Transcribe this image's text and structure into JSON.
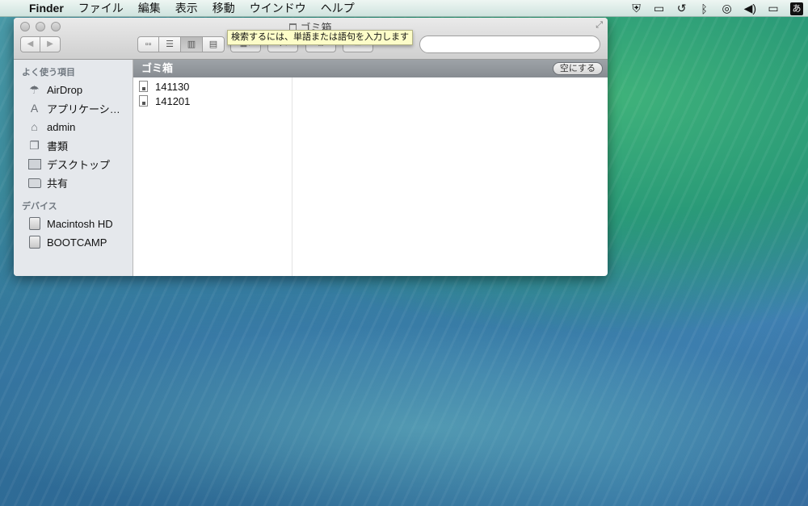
{
  "menubar": {
    "apple": "",
    "app": "Finder",
    "items": [
      "ファイル",
      "編集",
      "表示",
      "移動",
      "ウインドウ",
      "ヘルプ"
    ],
    "ime": "あ"
  },
  "window": {
    "title": "ゴミ箱",
    "tooltip": "検索するには、単語または語句を入力します",
    "search": {
      "value": "",
      "placeholder": ""
    }
  },
  "sidebar": {
    "favorites_header": "よく使う項目",
    "favorites": [
      {
        "label": "AirDrop",
        "icon": "airdrop-icon"
      },
      {
        "label": "アプリケーシ…",
        "icon": "applications-icon"
      },
      {
        "label": "admin",
        "icon": "home-icon"
      },
      {
        "label": "書類",
        "icon": "documents-icon"
      },
      {
        "label": "デスクトップ",
        "icon": "desktop-icon"
      },
      {
        "label": "共有",
        "icon": "folder-icon"
      }
    ],
    "devices_header": "デバイス",
    "devices": [
      {
        "label": "Macintosh HD",
        "icon": "disk-icon"
      },
      {
        "label": "BOOTCAMP",
        "icon": "disk-icon"
      }
    ]
  },
  "pathbar": {
    "title": "ゴミ箱",
    "empty_button": "空にする"
  },
  "files": [
    "141130",
    "141201"
  ]
}
